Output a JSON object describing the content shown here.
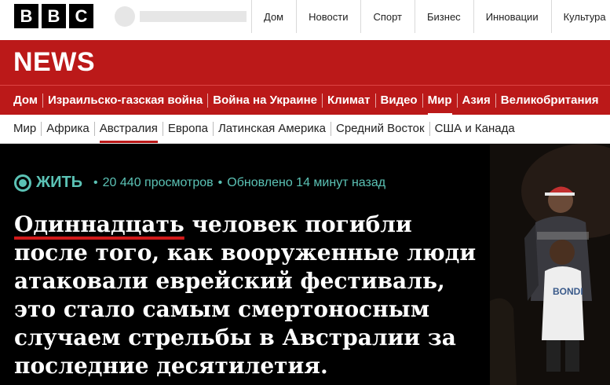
{
  "brand": {
    "letters": [
      "B",
      "B",
      "C"
    ]
  },
  "top_nav": [
    "Дом",
    "Новости",
    "Спорт",
    "Бизнес",
    "Инновации",
    "Культура"
  ],
  "news_title": "NEWS",
  "red_nav": {
    "items": [
      "Дом",
      "Израильско-газская война",
      "Война на Украине",
      "Климат",
      "Видео",
      "Мир",
      "Азия",
      "Великобритания"
    ],
    "active": "Мир"
  },
  "sub_nav": {
    "items": [
      "Мир",
      "Африка",
      "Австралия",
      "Европа",
      "Латинская Америка",
      "Средний Восток",
      "США и Канада"
    ],
    "active": "Австралия"
  },
  "live": {
    "label": "ЖИТЬ",
    "views": "20 440 просмотров",
    "updated": "Обновлено 14 минут назад",
    "color": "#5bc2b5"
  },
  "headline": {
    "highlight": "Одиннадцать",
    "rest": " человек погибли после того, как вооруженные люди атаковали еврейский фестиваль, это стало самым смертоносным случаем стрельбы в Австралии за последние десятилетия."
  },
  "photo": {
    "shirt_text": "BONDI"
  },
  "colors": {
    "bbc_red": "#bb1919",
    "underline": "#d01a1a"
  }
}
